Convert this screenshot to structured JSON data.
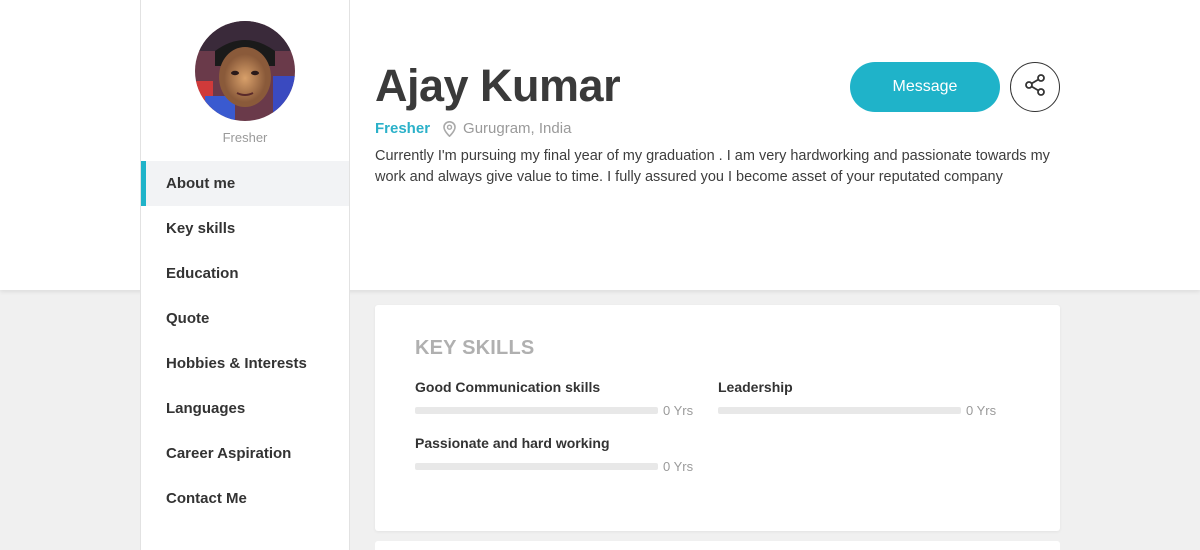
{
  "profile": {
    "name": "Ajay Kumar",
    "status": "Fresher",
    "avatar_caption": "Fresher",
    "location": "Gurugram, India",
    "bio": "Currently I'm pursuing my final year of my graduation . I am very hardworking and passionate towards my work and always give value to time. I fully assured you I become asset of your reputated company"
  },
  "actions": {
    "message_label": "Message",
    "share_icon": "share-icon"
  },
  "nav": {
    "items": [
      {
        "label": "About me",
        "active": true
      },
      {
        "label": "Key skills",
        "active": false
      },
      {
        "label": "Education",
        "active": false
      },
      {
        "label": "Quote",
        "active": false
      },
      {
        "label": "Hobbies & Interests",
        "active": false
      },
      {
        "label": "Languages",
        "active": false
      },
      {
        "label": "Career Aspiration",
        "active": false
      },
      {
        "label": "Contact Me",
        "active": false
      }
    ]
  },
  "key_skills": {
    "title": "KEY SKILLS",
    "skills": [
      {
        "name": "Good Communication skills",
        "years": "0 Yrs",
        "level": 0
      },
      {
        "name": "Leadership",
        "years": "0 Yrs",
        "level": 0
      },
      {
        "name": "Passionate and hard working",
        "years": "0 Yrs",
        "level": 0
      }
    ]
  },
  "colors": {
    "accent": "#1fb3c9",
    "muted_text": "#9a9a9a",
    "page_bg": "#f0f0f0"
  }
}
